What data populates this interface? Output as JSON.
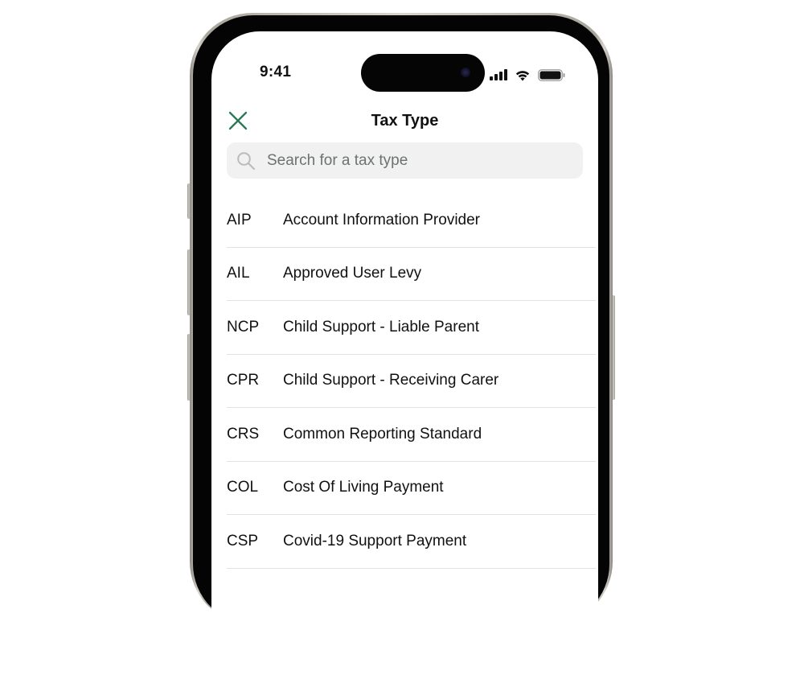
{
  "status_bar": {
    "time": "9:41",
    "icons": [
      "cellular-signal-icon",
      "wifi-icon",
      "battery-icon"
    ]
  },
  "header": {
    "close_icon": "close-icon",
    "title": "Tax Type"
  },
  "search": {
    "icon": "search-icon",
    "placeholder": "Search for a tax type",
    "value": ""
  },
  "tax_types": [
    {
      "code": "AIP",
      "name": "Account Information Provider"
    },
    {
      "code": "AIL",
      "name": "Approved User Levy"
    },
    {
      "code": "NCP",
      "name": "Child Support - Liable Parent"
    },
    {
      "code": "CPR",
      "name": "Child Support - Receiving Carer"
    },
    {
      "code": "CRS",
      "name": "Common Reporting Standard"
    },
    {
      "code": "COL",
      "name": "Cost Of Living Payment"
    },
    {
      "code": "CSP",
      "name": "Covid-19 Support Payment"
    }
  ],
  "colors": {
    "accent": "#2a7a55",
    "search_bg": "#f0f1f0",
    "divider": "#e2e2e2"
  }
}
